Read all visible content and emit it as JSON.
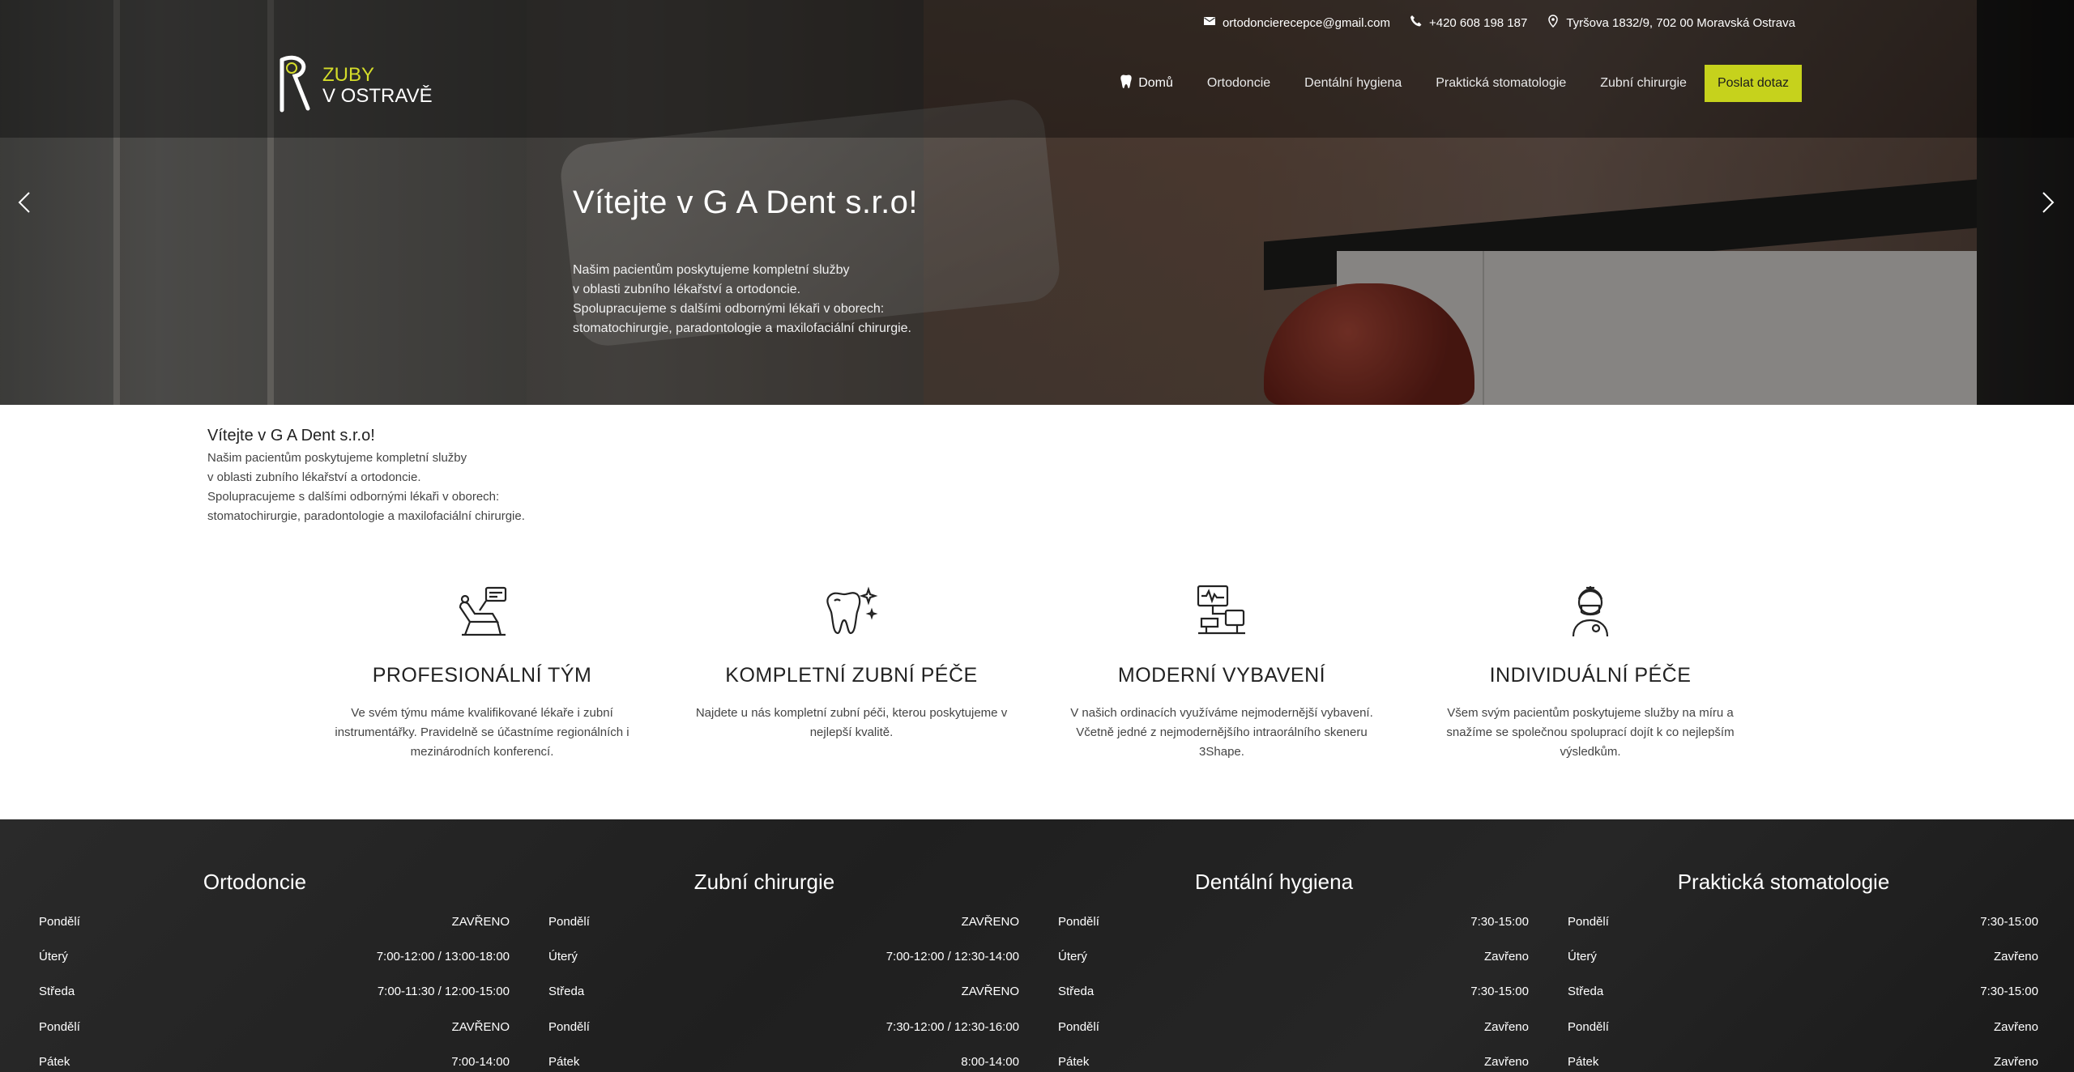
{
  "topbar": {
    "email": "ortodoncierecepce@gmail.com",
    "phone": "+420 608 198 187",
    "address": "Tyršova 1832/9, 702 00 Moravská Ostrava"
  },
  "logo": {
    "line1": "ZUBY",
    "line2": "V OSTRAVĚ"
  },
  "nav": {
    "items": [
      "Domů",
      "Ortodoncie",
      "Dentální hygiena",
      "Praktická stomatologie",
      "Zubní chirurgie"
    ],
    "cta": "Poslat dotaz"
  },
  "hero": {
    "title": "Vítejte v G A Dent s.r.o!",
    "lines": [
      "Našim pacientům poskytujeme kompletní služby",
      "v oblasti zubního lékařství a ortodoncie.",
      "Spolupracujeme s dalšími odbornými lékaři v oborech:",
      "stomatochirurgie, paradontologie a maxilofaciální chirurgie."
    ]
  },
  "intro": {
    "title": "Vítejte v G A Dent s.r.o!",
    "lines": [
      "Našim pacientům poskytujeme kompletní služby",
      "v oblasti zubního lékařství a ortodoncie.",
      "Spolupracujeme s dalšími odbornými lékaři v oborech:",
      "stomatochirurgie, paradontologie a maxilofaciální chirurgie."
    ]
  },
  "features": [
    {
      "icon": "dental-chair-icon",
      "title": "PROFESIONÁLNÍ TÝM",
      "text": "Ve svém týmu máme kvalifikované lékaře i zubní instrumentářky. Pravidelně se účastníme regionálních i mezinárodních konferencí."
    },
    {
      "icon": "sparkling-tooth-icon",
      "title": "KOMPLETNÍ ZUBNÍ PÉČE",
      "text": "Najdete u nás kompletní zubní péči, kterou poskytujeme v nejlepší kvalitě."
    },
    {
      "icon": "dental-equipment-icon",
      "title": "MODERNÍ VYBAVENÍ",
      "text": "V našich ordinacích využíváme nejmodernější vybavení. Včetně jedné z nejmodernějšího intraorálního skeneru 3Shape."
    },
    {
      "icon": "dentist-icon",
      "title": "INDIVIDUÁLNÍ PÉČE",
      "text": "Všem svým pacientům poskytujeme služby na míru a snažíme se společnou spoluprací dojít k co nejlepším výsledkům."
    }
  ],
  "hours": [
    {
      "title": "Ortodoncie",
      "rows": [
        {
          "day": "Pondělí",
          "hours": "ZAVŘENO"
        },
        {
          "day": "Úterý",
          "hours": "7:00-12:00 / 13:00-18:00"
        },
        {
          "day": "Středa",
          "hours": "7:00-11:30 / 12:00-15:00"
        },
        {
          "day": "Pondělí",
          "hours": "ZAVŘENO"
        },
        {
          "day": "Pátek",
          "hours": "7:00-14:00"
        }
      ]
    },
    {
      "title": "Zubní chirurgie",
      "rows": [
        {
          "day": "Pondělí",
          "hours": "ZAVŘENO"
        },
        {
          "day": "Úterý",
          "hours": "7:00-12:00 / 12:30-14:00"
        },
        {
          "day": "Středa",
          "hours": "ZAVŘENO"
        },
        {
          "day": "Pondělí",
          "hours": "7:30-12:00 / 12:30-16:00"
        },
        {
          "day": "Pátek",
          "hours": "8:00-14:00"
        }
      ]
    },
    {
      "title": "Dentální hygiena",
      "rows": [
        {
          "day": "Pondělí",
          "hours": "7:30-15:00"
        },
        {
          "day": "Úterý",
          "hours": "Zavřeno"
        },
        {
          "day": "Středa",
          "hours": "7:30-15:00"
        },
        {
          "day": "Pondělí",
          "hours": "Zavřeno"
        },
        {
          "day": "Pátek",
          "hours": "Zavřeno"
        }
      ]
    },
    {
      "title": "Praktická stomatologie",
      "rows": [
        {
          "day": "Pondělí",
          "hours": "7:30-15:00"
        },
        {
          "day": "Úterý",
          "hours": "Zavřeno"
        },
        {
          "day": "Středa",
          "hours": "7:30-15:00"
        },
        {
          "day": "Pondělí",
          "hours": "Zavřeno"
        },
        {
          "day": "Pátek",
          "hours": "Zavřeno"
        }
      ]
    }
  ],
  "colors": {
    "accent": "#c6d21c",
    "logo_accent": "#d4dc2a",
    "footer_bg": "#222222"
  }
}
